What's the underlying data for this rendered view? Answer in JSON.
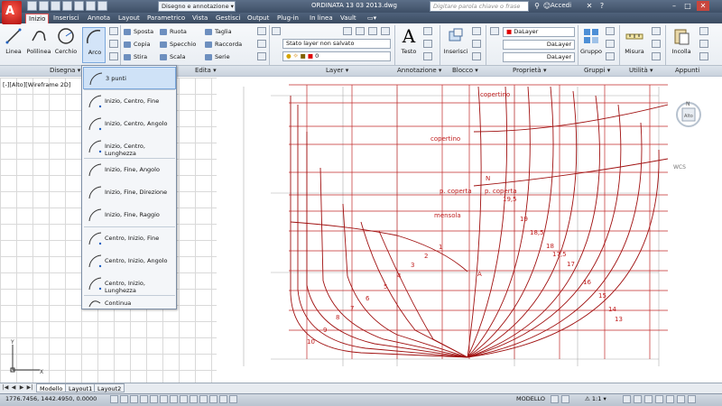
{
  "titlebar": {
    "workspace": "Disegno e annotazione",
    "document_title": "ORDINATA 13 03 2013.dwg",
    "search_placeholder": "Digitare parola chiave o frase",
    "login": "Accedi"
  },
  "tabs": [
    "Inizio",
    "Inserisci",
    "Annota",
    "Layout",
    "Parametrico",
    "Vista",
    "Gestisci",
    "Output",
    "Plug-in",
    "In linea",
    "Vault"
  ],
  "active_tab": "Inizio",
  "ribbon": {
    "draw": {
      "title": "Disegna",
      "buttons": [
        "Linea",
        "Polilinea",
        "Cerchio",
        "Arco"
      ]
    },
    "modify": {
      "title": "Edita",
      "items": [
        "Sposta",
        "Ruota",
        "Taglia",
        "Copia",
        "Specchio",
        "Raccorda",
        "Stira",
        "Scala",
        "Serie"
      ]
    },
    "layer": {
      "title": "Layer",
      "state": "Stato layer non salvato",
      "current": "0"
    },
    "annotation": {
      "title": "Annotazione",
      "button": "Testo"
    },
    "block": {
      "title": "Blocco",
      "button": "Inserisci"
    },
    "properties": {
      "title": "Proprietà",
      "color": "DaLayer",
      "linetype": "DaLayer",
      "lineweight": "DaLayer"
    },
    "groups": {
      "title": "Gruppi",
      "button": "Gruppo"
    },
    "utility": {
      "title": "Utilità",
      "button": "Misura"
    },
    "clipboard": {
      "title": "Appunti",
      "button": "Incolla"
    }
  },
  "viewport_label": "[-][Alto][Wireframe 2D]",
  "arc_menu": {
    "items": [
      "3 punti",
      "Inizio, Centro, Fine",
      "Inizio, Centro, Angolo",
      "Inizio, Centro, Lunghezza",
      "Inizio, Fine, Angolo",
      "Inizio, Fine, Direzione",
      "Inizio, Fine, Raggio",
      "Centro, Inizio, Fine",
      "Centro, Inizio, Angolo",
      "Centro, Inizio, Lunghezza",
      "Continua"
    ],
    "selected": "3 punti"
  },
  "drawing_labels": {
    "coperting": "copertino",
    "coperting2": "copertino",
    "p_coperta1": "p. coperta",
    "p_coperta2": "p. coperta",
    "mensola": "mensola",
    "N": "N",
    "A": "A",
    "numbers": [
      "19,5",
      "19",
      "18,5",
      "18",
      "17,5",
      "17",
      "16",
      "15",
      "14",
      "13",
      "12",
      "10",
      "9",
      "8",
      "7",
      "6",
      "5",
      "4",
      "3",
      "2",
      "1"
    ]
  },
  "viewcube": {
    "north": "N",
    "top": "Alto",
    "wcs": "WCS"
  },
  "layout_tabs": [
    "Modello",
    "Layout1",
    "Layout2"
  ],
  "status": {
    "coordinates": "1776.7456, 1442.4950, 0.0000",
    "model": "MODELLO",
    "scale": "1:1"
  },
  "colors": {
    "accent": "#e03a3a",
    "hull_lines": "#b81a1a",
    "ribbon_bg": "#eaeef3"
  }
}
